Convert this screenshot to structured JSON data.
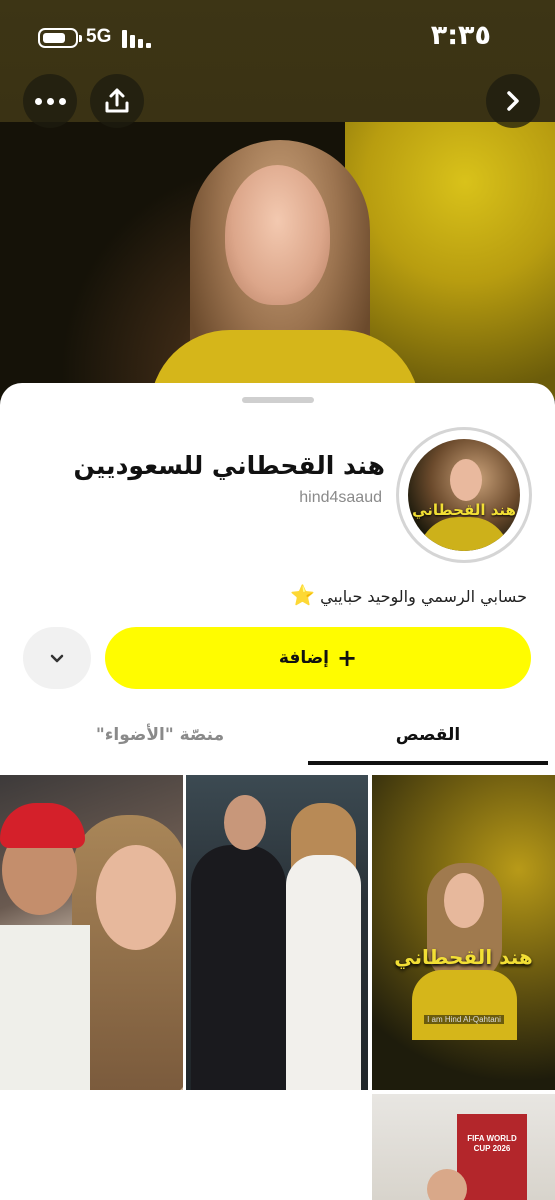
{
  "status_bar": {
    "network": "5G",
    "time": "٣:٣٥"
  },
  "hero": {
    "more_icon": "more-horizontal-icon",
    "share_icon": "share-icon",
    "next_icon": "chevron-right-icon"
  },
  "profile": {
    "display_name": "هند القحطاني للسعوديين",
    "username": "hind4saaud",
    "avatar_caption": "هند القحطاني",
    "bio": "حسابي الرسمي والوحيد حبايبي",
    "bio_emoji": "⭐"
  },
  "actions": {
    "add_label": "إضافة",
    "add_icon": "plus-icon",
    "dropdown_icon": "chevron-down-icon"
  },
  "tabs": [
    {
      "label": "القصص",
      "active": true
    },
    {
      "label": "منصّة \"الأضواء\"",
      "active": false
    }
  ],
  "tiles": {
    "tile3_caption": "هند القحطاني",
    "tile3_sub": "I am Hind Al-Qahtani",
    "tile4_poster": "FIFA WORLD CUP 2026"
  },
  "colors": {
    "accent_yellow": "#FFFC00",
    "text_primary": "#111111",
    "text_secondary": "#8A8A8A"
  }
}
